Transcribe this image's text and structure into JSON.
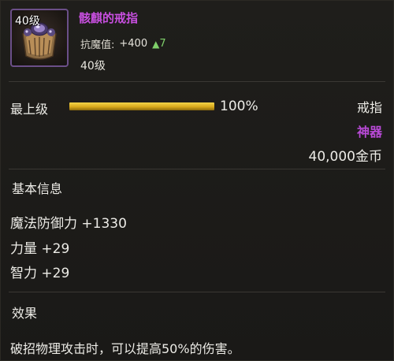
{
  "item": {
    "icon": "ring-icon",
    "level_tag": "40级",
    "name": "骸麒的戒指",
    "resist_label": "抗魔值:",
    "resist_value": "+400",
    "resist_delta": "7",
    "level_text": "40级"
  },
  "grade": {
    "label": "最上级",
    "percent_text": "100%",
    "percent": 100
  },
  "meta": {
    "slot": "戒指",
    "rarity": "神器",
    "price": "40,000金币"
  },
  "basic_info": {
    "title": "基本信息",
    "stats": [
      "魔法防御力 +1330",
      "力量 +29",
      "智力 +29"
    ]
  },
  "effect": {
    "title": "效果",
    "text": "破招物理攻击时，可以提高50%的伤害。"
  },
  "colors": {
    "name": "#c84fe0",
    "rarity": "#b84ad6",
    "frame": "#6b4f88",
    "bar": "#e0b52a",
    "delta": "#7fd06a"
  }
}
